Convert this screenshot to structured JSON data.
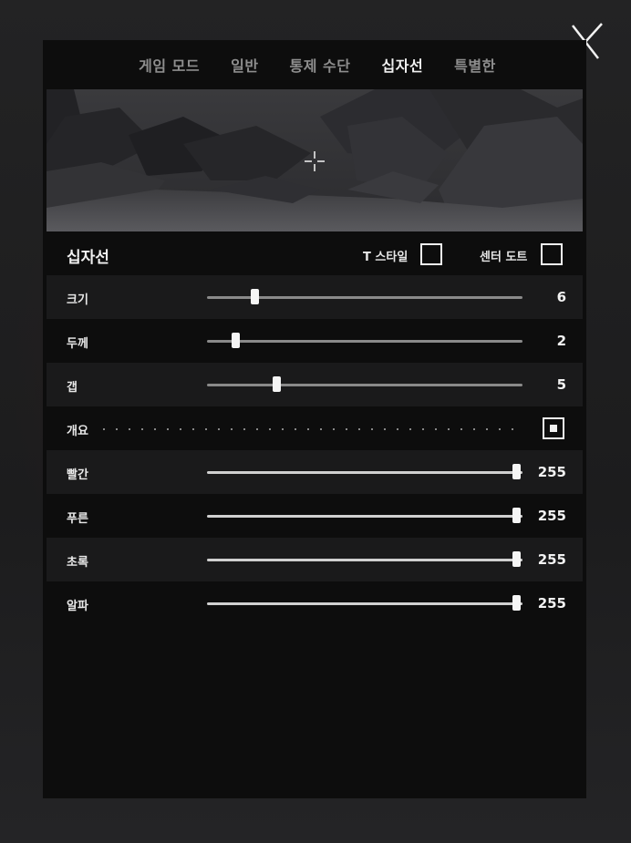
{
  "tabs": [
    {
      "label": "게임 모드",
      "active": false
    },
    {
      "label": "일반",
      "active": false
    },
    {
      "label": "통제 수단",
      "active": false
    },
    {
      "label": "십자선",
      "active": true
    },
    {
      "label": "특별한",
      "active": false
    }
  ],
  "crosshair_section": {
    "title": "십자선",
    "t_style_label": "T 스타일",
    "t_style_checked": false,
    "center_dot_label": "센터 도트",
    "center_dot_checked": false
  },
  "settings": {
    "size": {
      "label": "크기",
      "value": "6",
      "fraction": 0.15
    },
    "thickness": {
      "label": "두께",
      "value": "2",
      "fraction": 0.09
    },
    "gap": {
      "label": "갭",
      "value": "5",
      "fraction": 0.22
    },
    "outline": {
      "label": "개요",
      "checked": true
    },
    "red": {
      "label": "빨간",
      "value": "255",
      "fraction": 0.98
    },
    "blue": {
      "label": "푸른",
      "value": "255",
      "fraction": 0.98
    },
    "green": {
      "label": "초록",
      "value": "255",
      "fraction": 0.98
    },
    "alpha": {
      "label": "알파",
      "value": "255",
      "fraction": 0.98
    }
  },
  "icons": {
    "close": "close-x-icon",
    "crosshair_preview": "crosshair-icon"
  },
  "colors": {
    "panel_bg": "#0d0d0d",
    "row_shade": "#1a1a1b",
    "text_primary": "#f2f2f2",
    "text_muted": "#8e8e8e"
  }
}
